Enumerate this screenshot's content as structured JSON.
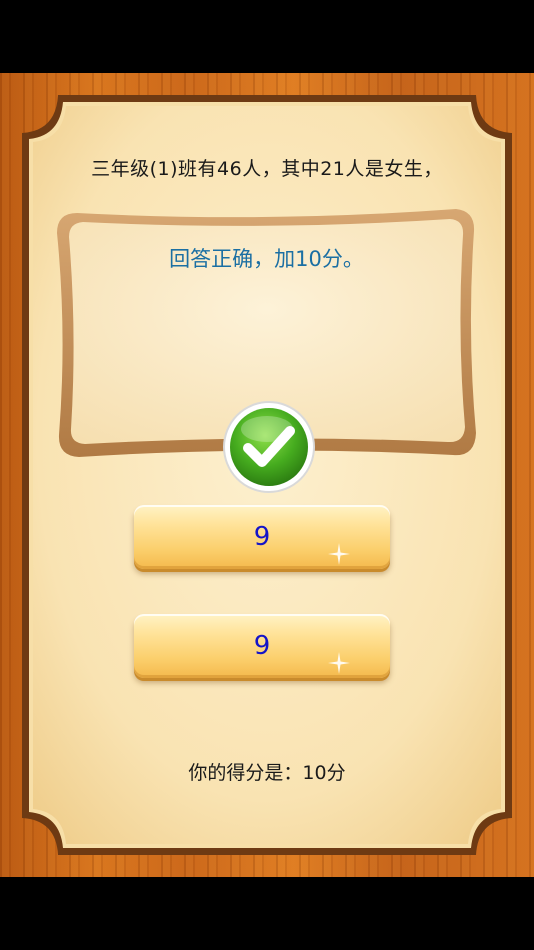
{
  "question": {
    "text": "三年级(1)班有46人，其中21人是女生，"
  },
  "feedback": {
    "text": "回答正确，加10分。",
    "status": "correct"
  },
  "options": [
    {
      "label": "9"
    },
    {
      "label": "9"
    }
  ],
  "score": {
    "text": "你的得分是：10分"
  },
  "colors": {
    "wood": "#cf6b1c",
    "panel": "#fbe6b8",
    "panel_border": "#6e3a13",
    "feedback_text": "#1b6fa3",
    "option_text": "#1414c8",
    "check_green": "#3fa51e"
  },
  "icons": {
    "status": "check-icon"
  }
}
